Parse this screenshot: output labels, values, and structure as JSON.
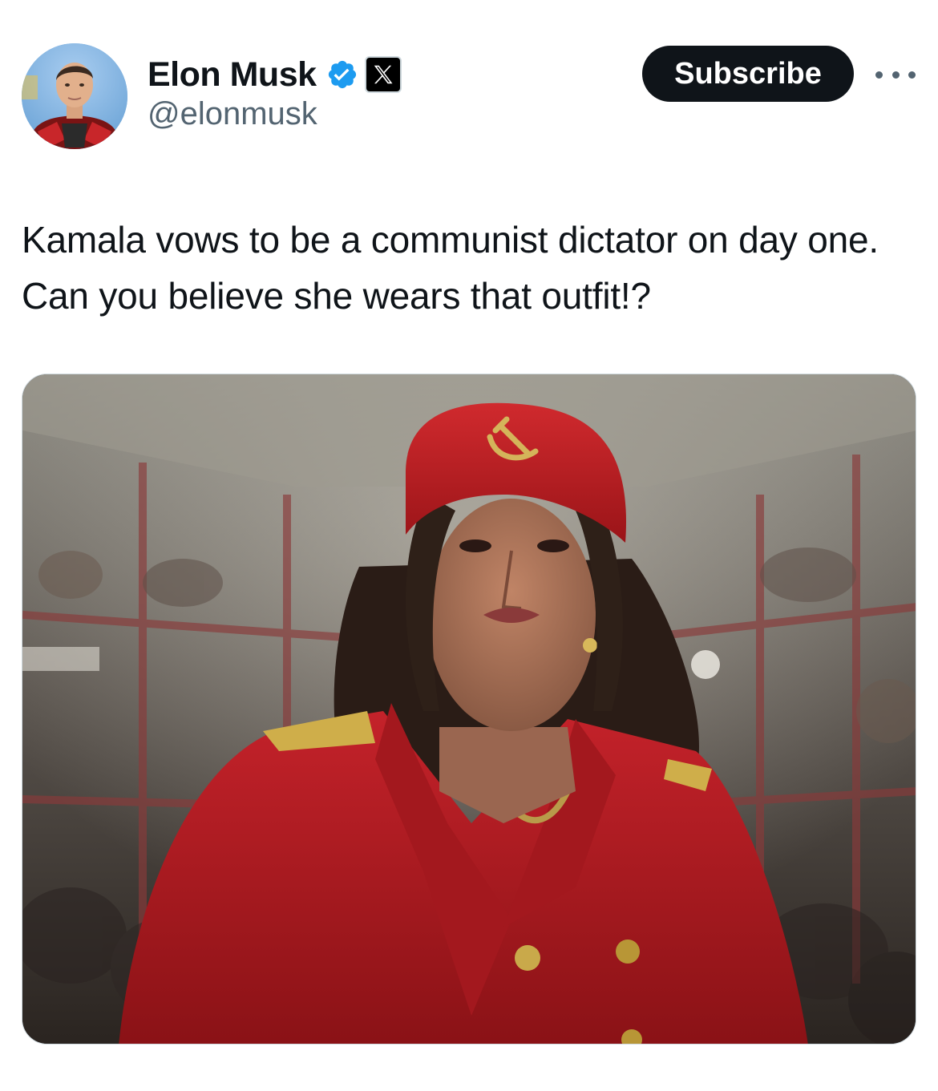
{
  "author": {
    "display_name": "Elon Musk",
    "handle": "@elonmusk",
    "verified": true,
    "verified_color": "#1d9bf0",
    "affiliate_icon": "x-logo-icon"
  },
  "actions": {
    "subscribe_label": "Subscribe",
    "more_icon": "more-horizontal-icon"
  },
  "tweet": {
    "text": "Kamala vows to be a communist dictator on day one. Can you believe she wears that outfit!?"
  },
  "media": {
    "description_icon": "photo",
    "accent_color": "#b81c22"
  }
}
